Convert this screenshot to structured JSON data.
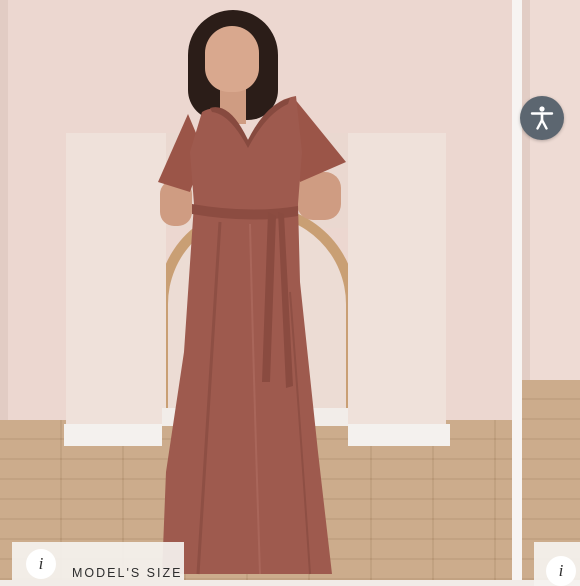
{
  "product_gallery": {
    "main_image_alt": "",
    "model_size_label": "MODEL'S SIZE",
    "info_icon_glyph": "i",
    "accessibility_icon": "accessibility-icon",
    "dress_color": "#9e5a4e",
    "wall_color": "#ecd7d0"
  }
}
